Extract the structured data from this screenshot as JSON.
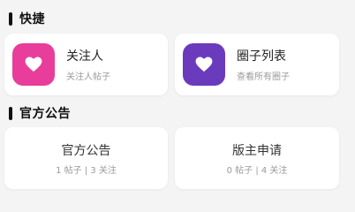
{
  "sections": {
    "quick": {
      "title": "快捷",
      "items": [
        {
          "title": "关注人",
          "subtitle": "关注人帖子",
          "icon": "heart-icon",
          "color": "#e83d9a"
        },
        {
          "title": "圈子列表",
          "subtitle": "查看所有圈子",
          "icon": "heart-icon",
          "color": "#6a3bbd"
        }
      ]
    },
    "official": {
      "title": "官方公告",
      "items": [
        {
          "title": "官方公告",
          "stats": "1 帖子 | 3 关注"
        },
        {
          "title": "版主申请",
          "stats": "0 帖子 | 4 关注"
        }
      ]
    }
  }
}
